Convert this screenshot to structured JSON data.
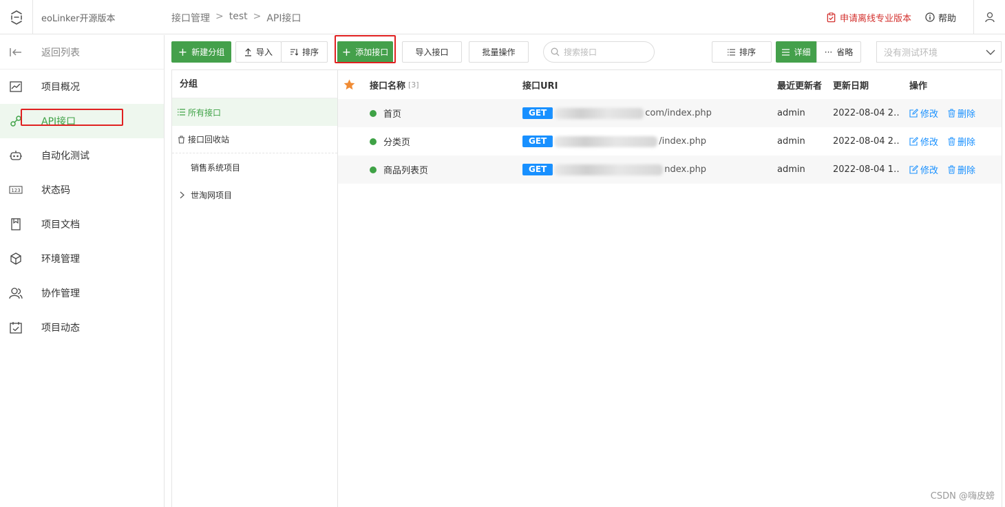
{
  "header": {
    "app_title": "eoLinker开源版本",
    "breadcrumb": [
      "接口管理",
      "test",
      "API接口"
    ],
    "pro_link": "申请离线专业版本",
    "help": "帮助"
  },
  "sidebar": {
    "back": "返回列表",
    "items": [
      {
        "label": "项目概况",
        "icon": "chart-icon"
      },
      {
        "label": "API接口",
        "icon": "link-icon"
      },
      {
        "label": "自动化测试",
        "icon": "robot-icon"
      },
      {
        "label": "状态码",
        "icon": "code-123-icon"
      },
      {
        "label": "项目文档",
        "icon": "document-icon"
      },
      {
        "label": "环境管理",
        "icon": "cube-icon"
      },
      {
        "label": "协作管理",
        "icon": "users-icon"
      },
      {
        "label": "项目动态",
        "icon": "calendar-icon"
      }
    ]
  },
  "toolbar": {
    "new_group": "新建分组",
    "import": "导入",
    "sort": "排序",
    "add_api": "添加接口",
    "import_api": "导入接口",
    "batch": "批量操作",
    "search_placeholder": "搜索接口",
    "sort_right": "排序",
    "detail": "详细",
    "brief": "省略",
    "env_placeholder": "没有测试环境"
  },
  "groups": {
    "header": "分组",
    "all": "所有接口",
    "recycle": "接口回收站",
    "items": [
      "销售系统项目",
      "世淘网项目"
    ]
  },
  "table": {
    "columns": {
      "name": "接口名称",
      "count": "[3]",
      "uri": "接口URI",
      "updater": "最近更新者",
      "date": "更新日期",
      "ops": "操作"
    },
    "rows": [
      {
        "name": "首页",
        "method": "GET",
        "uri_tail": "com/index.php",
        "updater": "admin",
        "date": "2022-08-04 2…",
        "edit": "修改",
        "delete": "删除"
      },
      {
        "name": "分类页",
        "method": "GET",
        "uri_tail": "/index.php",
        "updater": "admin",
        "date": "2022-08-04 2…",
        "edit": "修改",
        "delete": "删除"
      },
      {
        "name": "商品列表页",
        "method": "GET",
        "uri_tail": "ndex.php",
        "updater": "admin",
        "date": "2022-08-04 1…",
        "edit": "修改",
        "delete": "删除"
      }
    ]
  },
  "watermark": "CSDN @嗨皮螃",
  "colors": {
    "accent": "#44a04b",
    "link": "#1890ff",
    "alert": "#d3312e",
    "highlight_box": "#e02020"
  }
}
